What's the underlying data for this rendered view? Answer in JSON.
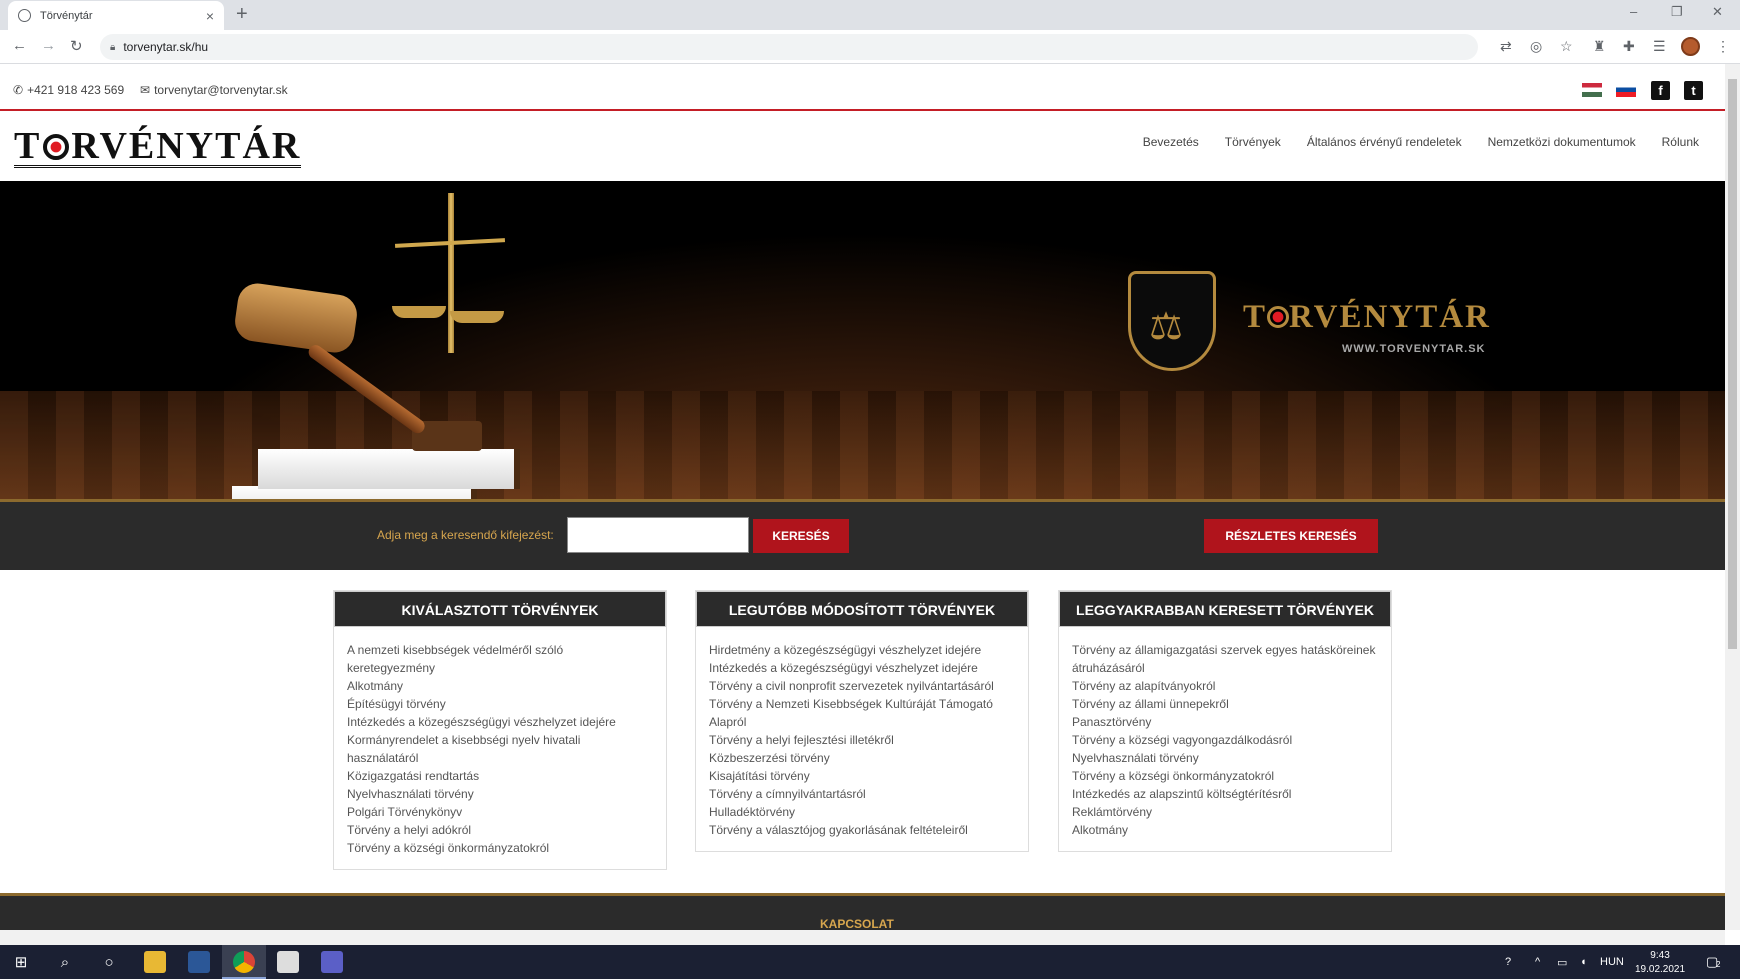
{
  "browser": {
    "tab_title": "Törvénytár",
    "tab_close": "×",
    "new_tab": "+",
    "url": "torvenytar.sk/hu",
    "win_min": "–",
    "win_restore": "❐",
    "win_close": "✕"
  },
  "topbar": {
    "phone": "+421 918 423 569",
    "email": "torvenytar@torvenytar.sk",
    "facebook": "f",
    "twitter": "t"
  },
  "header": {
    "logo_left": "T",
    "logo_right": "RVÉNYTÁR",
    "nav": [
      "Bevezetés",
      "Törvények",
      "Általános érvényű rendeletek",
      "Nemzetközi dokumentumok",
      "Rólunk"
    ]
  },
  "hero": {
    "brand_left": "T",
    "brand_right": "RVÉNYTÁR",
    "brand_url": "WWW.TORVENYTAR.SK"
  },
  "search": {
    "label": "Adja meg a keresendő kifejezést:",
    "value": "",
    "button": "KERESÉS",
    "advanced_button": "RÉSZLETES KERESÉS"
  },
  "panels": [
    {
      "title": "KIVÁLASZTOTT TÖRVÉNYEK",
      "items": [
        "A nemzeti kisebbségek védelméről szóló keretegyezmény",
        "Alkotmány",
        "Építésügyi törvény",
        "Intézkedés a közegészségügyi vészhelyzet idejére",
        "Kormányrendelet a kisebbségi nyelv hivatali használatáról",
        "Közigazgatási rendtartás",
        "Nyelvhasználati törvény",
        "Polgári Törvénykönyv",
        "Törvény a helyi adókról",
        "Törvény a községi önkormányzatokról"
      ]
    },
    {
      "title": "LEGUTÓBB MÓDOSÍTOTT TÖRVÉNYEK",
      "items": [
        "Hirdetmény a közegészségügyi vészhelyzet idejére",
        "Intézkedés a közegészségügyi vészhelyzet idejére",
        "Törvény a civil nonprofit szervezetek nyilvántartásáról",
        "Törvény a Nemzeti Kisebbségek Kultúráját Támogató Alapról",
        "Törvény a helyi fejlesztési illetékről",
        "Közbeszerzési törvény",
        "Kisajátítási törvény",
        "Törvény a címnyilvántartásról",
        "Hulladéktörvény",
        "Törvény a választójog gyakorlásának feltételeiről"
      ]
    },
    {
      "title": "LEGGYAKRABBAN KERESETT TÖRVÉNYEK",
      "items": [
        "Törvény az államigazgatási szervek egyes hatásköreinek átruházásáról",
        "Törvény az alapítványokról",
        "Törvény az állami ünnepekről",
        "Panasztörvény",
        "Törvény a községi vagyongazdálkodásról",
        "Nyelvhasználati törvény",
        "Törvény a községi önkormányzatokról",
        "Intézkedés az alapszintű költségtérítésről",
        "Reklámtörvény",
        "Alkotmány"
      ]
    }
  ],
  "footer": {
    "title": "KAPCSOLAT"
  },
  "taskbar": {
    "lang": "HUN",
    "time": "9:43",
    "date": "19.02.2021",
    "notif_count": "2"
  }
}
